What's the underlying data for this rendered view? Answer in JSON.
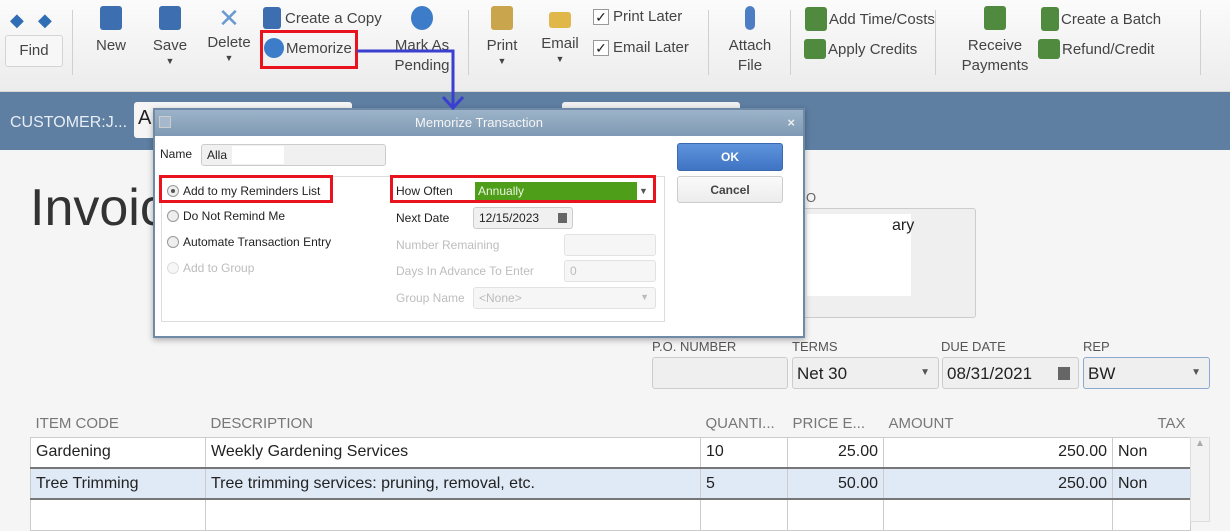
{
  "toolbar": {
    "find": "Find",
    "new": "New",
    "save": "Save",
    "delete": "Delete",
    "create_copy": "Create a Copy",
    "memorize": "Memorize",
    "mark_as_pending": [
      "Mark As",
      "Pending"
    ],
    "print": "Print",
    "email": "Email",
    "print_later": "Print Later",
    "email_later": "Email Later",
    "attach_file": [
      "Attach",
      "File"
    ],
    "add_time_costs": "Add Time/Costs",
    "apply_credits": "Apply Credits",
    "receive_payments": [
      "Receive",
      "Payments"
    ],
    "create_batch": "Create a Batch",
    "refund_credit": "Refund/Credit",
    "check_mark": "✓"
  },
  "header": {
    "customer_label": "CUSTOMER:J...",
    "customer_value": "A"
  },
  "form": {
    "title": "Invoic",
    "bill_to_label": "O",
    "bill_to_partial": "ary",
    "po_label": "P.O. NUMBER",
    "terms_label": "TERMS",
    "terms_value": "Net 30",
    "due_label": "DUE DATE",
    "due_value": "08/31/2021",
    "rep_label": "REP",
    "rep_value": "BW"
  },
  "dialog": {
    "title": "Memorize Transaction",
    "close": "×",
    "name_label": "Name",
    "name_value": "Alla",
    "options": [
      "Add to my Reminders List",
      "Do Not Remind Me",
      "Automate Transaction Entry",
      "Add to Group"
    ],
    "how_often_label": "How Often",
    "how_often_value": "Annually",
    "next_date_label": "Next Date",
    "next_date_value": "12/15/2023",
    "number_remaining_label": "Number Remaining",
    "days_in_advance_label": "Days In Advance To Enter",
    "days_in_advance_value": "0",
    "group_name_label": "Group Name",
    "group_name_value": "<None>",
    "ok": "OK",
    "cancel": "Cancel"
  },
  "table": {
    "headers": [
      "ITEM CODE",
      "DESCRIPTION",
      "QUANTI...",
      "PRICE E...",
      "AMOUNT",
      "TAX"
    ],
    "rows": [
      [
        "Gardening",
        "Weekly Gardening Services",
        "10",
        "25.00",
        "250.00",
        "Non"
      ],
      [
        "Tree Trimming",
        "Tree trimming services: pruning, removal, etc.",
        "5",
        "50.00",
        "250.00",
        "Non"
      ]
    ]
  },
  "colors": {
    "highlight": "#e8131c",
    "arrow": "#3a3fd0",
    "how_often_bg": "#4f9e19",
    "header_bar": "#5e7ea2"
  }
}
